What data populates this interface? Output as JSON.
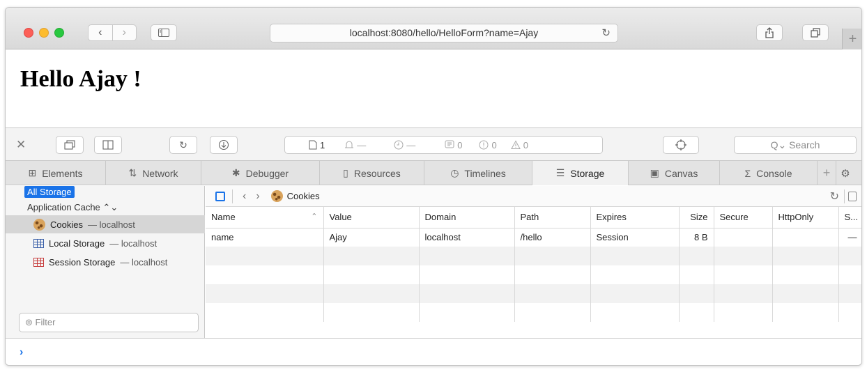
{
  "browser": {
    "url": "localhost:8080/hello/HelloForm?name=Ajay"
  },
  "page": {
    "heading": "Hello Ajay !"
  },
  "inspector_toolbar": {
    "resource_count": "1",
    "load_indicator": "—",
    "time_indicator": "—",
    "log_count": "0",
    "error_count": "0",
    "warning_count": "0",
    "search_placeholder": "Search"
  },
  "tabs": [
    {
      "label": "Elements",
      "icon": "elements-icon"
    },
    {
      "label": "Network",
      "icon": "network-icon"
    },
    {
      "label": "Debugger",
      "icon": "debugger-icon"
    },
    {
      "label": "Resources",
      "icon": "resources-icon"
    },
    {
      "label": "Timelines",
      "icon": "timelines-icon"
    },
    {
      "label": "Storage",
      "icon": "storage-icon",
      "active": true
    },
    {
      "label": "Canvas",
      "icon": "canvas-icon"
    },
    {
      "label": "Console",
      "icon": "console-icon"
    }
  ],
  "sidebar": {
    "all_storage": "All Storage",
    "app_cache": "Application Cache",
    "items": [
      {
        "label": "Cookies",
        "host": "— localhost",
        "icon": "cookie-icon",
        "selected": true
      },
      {
        "label": "Local Storage",
        "host": "— localhost",
        "icon": "local-storage-icon"
      },
      {
        "label": "Session Storage",
        "host": "— localhost",
        "icon": "session-storage-icon"
      }
    ],
    "filter_placeholder": "Filter"
  },
  "content": {
    "breadcrumb": "Cookies",
    "table": {
      "columns": [
        "Name",
        "Value",
        "Domain",
        "Path",
        "Expires",
        "Size",
        "Secure",
        "HttpOnly",
        "S..."
      ],
      "rows": [
        [
          "name",
          "Ajay",
          "localhost",
          "/hello",
          "Session",
          "8 B",
          "",
          "",
          "—"
        ]
      ]
    }
  },
  "colors": {
    "accent": "#1a73e8",
    "close": "#fc5f57",
    "minimize": "#fdbc2e",
    "zoom": "#28c840"
  }
}
